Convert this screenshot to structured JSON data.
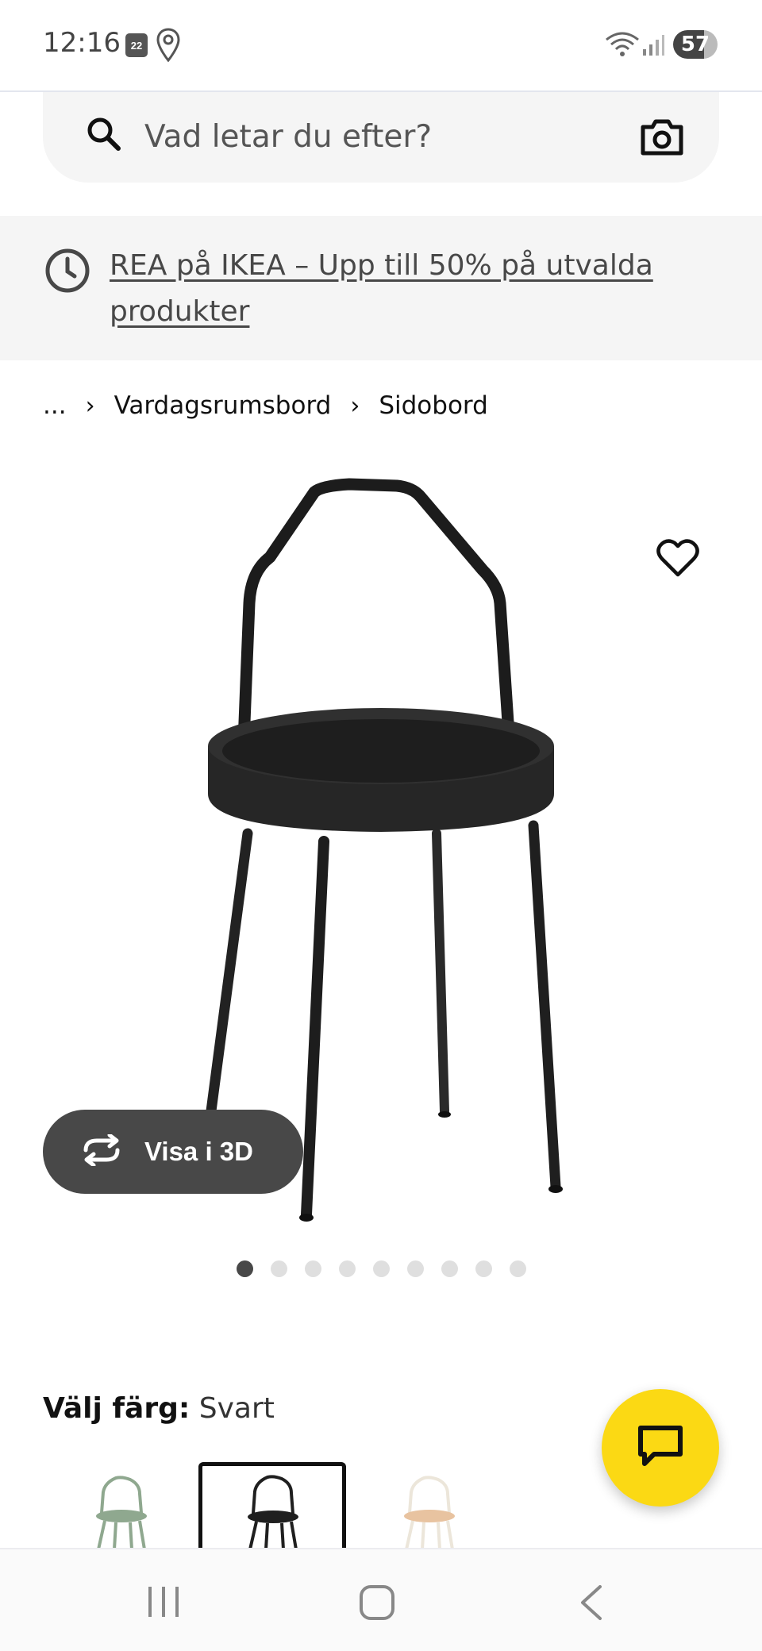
{
  "status_bar": {
    "time": "12:16",
    "calendar_day": "22",
    "battery": "57",
    "icons": [
      "calendar-icon",
      "location-icon",
      "wifi-icon",
      "signal-icon",
      "battery-icon"
    ]
  },
  "search": {
    "placeholder": "Vad letar du efter?",
    "icons": [
      "search-icon",
      "camera-icon"
    ]
  },
  "promo": {
    "text": "REA på IKEA – Upp till 50% på utvalda produkter",
    "icon": "clock-icon"
  },
  "breadcrumb": {
    "items": [
      "...",
      "Vardagsrumsbord",
      "Sidobord"
    ],
    "separator": "›"
  },
  "gallery": {
    "view_3d_label": "Visa i 3D",
    "image_count": 9,
    "active_index": 0,
    "icons": [
      "heart-icon",
      "rotate-3d-icon"
    ]
  },
  "color_choice": {
    "label": "Välj färg:",
    "selected": "Svart",
    "swatches": [
      {
        "color": "#8fa88f",
        "selected": false
      },
      {
        "color": "#1f1f1f",
        "selected": true
      },
      {
        "color": "#e8c3a0",
        "selected": false
      }
    ]
  },
  "chat": {
    "icon": "chat-bubble-icon",
    "color": "#fbd914"
  },
  "nav_bar": {
    "icons": [
      "recents-icon",
      "home-icon",
      "back-icon"
    ]
  },
  "colors": {
    "accent_yellow": "#fbd914",
    "dark_button": "#484848",
    "banner_bg": "#f5f5f5"
  }
}
